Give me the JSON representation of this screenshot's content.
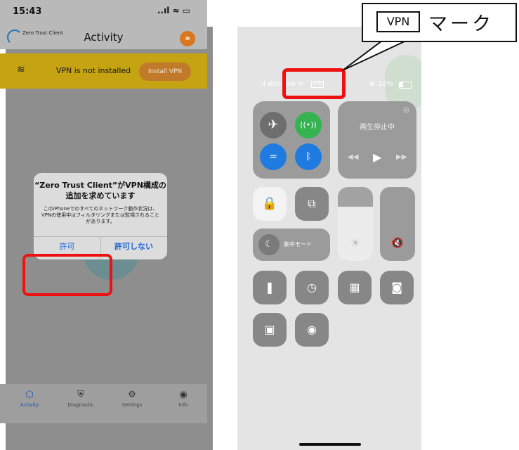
{
  "left_phone": {
    "status_time": "15:43",
    "status_icons": "..ıl ≈ ▭",
    "logo_text": "Zero Trust Client",
    "header_title": "Activity",
    "banner_text": "VPN is not installed",
    "install_label": "Install VPN",
    "dialog": {
      "title": "“Zero Trust Client”がVPN構成の追加を求めています",
      "body": "このiPhoneでのすべてのネットワーク動作状況は、VPNの使用中はフィルタリングまたは監視されることがあります。",
      "allow_label": "許可",
      "deny_label": "許可しない"
    },
    "tabs": [
      {
        "label": "Activity",
        "icon": "shield-check-icon"
      },
      {
        "label": "Diagnostic",
        "icon": "shield-icon"
      },
      {
        "label": "Settings",
        "icon": "gear-icon"
      },
      {
        "label": "Info",
        "icon": "person-circle-icon"
      }
    ]
  },
  "right_phone": {
    "status_carrier": "..ıl docomo ≈",
    "status_vpn": "VPN",
    "status_battery": "⊕ 32%",
    "media_title": "再生停止中",
    "focus_label": "集中モード"
  },
  "callout": {
    "tag": "VPN",
    "text": "マーク"
  },
  "colors": {
    "highlight": "#ee1111",
    "banner": "#c5a312",
    "install_button": "#c07a2a",
    "cellular_on": "#34b350",
    "wifi_on": "#1f7be0",
    "link_button": "#d9761f"
  }
}
